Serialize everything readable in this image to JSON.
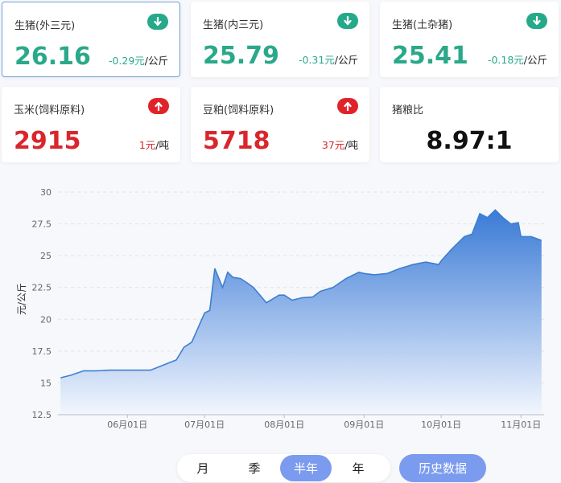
{
  "cards": [
    {
      "name": "生猪(外三元)",
      "price": "26.16",
      "change": "-0.29元",
      "unit": "/公斤",
      "trend": "down",
      "icon": "arrow-down-icon"
    },
    {
      "name": "生猪(内三元)",
      "price": "25.79",
      "change": "-0.31元",
      "unit": "/公斤",
      "trend": "down",
      "icon": "arrow-down-icon"
    },
    {
      "name": "生猪(土杂猪)",
      "price": "25.41",
      "change": "-0.18元",
      "unit": "/公斤",
      "trend": "down",
      "icon": "arrow-down-icon"
    },
    {
      "name": "玉米(饲料原料)",
      "price": "2915",
      "change": "1元",
      "unit": "/吨",
      "trend": "up",
      "icon": "arrow-up-icon"
    },
    {
      "name": "豆粕(饲料原料)",
      "price": "5718",
      "change": "37元",
      "unit": "/吨",
      "trend": "up",
      "icon": "arrow-up-icon"
    },
    {
      "name": "猪粮比",
      "price": "8.97:1"
    }
  ],
  "colors": {
    "down": "#25a98a",
    "up": "#e0232a",
    "accent": "#7b9bef",
    "line": "#3e7fcf",
    "area_top": "#3a7ad6",
    "area_bottom": "#f2f6fe"
  },
  "chart_data": {
    "type": "area",
    "ylabel": "元/公斤",
    "ylim": [
      12.5,
      30
    ],
    "yticks": [
      "12.5",
      "15",
      "17.5",
      "20",
      "22.5",
      "25",
      "27.5",
      "30"
    ],
    "xticks": [
      "06月01日",
      "07月01日",
      "08月01日",
      "09月01日",
      "10月01日",
      "11月01日"
    ],
    "grid": "horizontal dashed",
    "series": [
      {
        "x": [
          "05-06",
          "05-10",
          "05-15",
          "05-20",
          "05-25",
          "06-01",
          "06-05",
          "06-10",
          "06-15",
          "06-20",
          "06-23",
          "06-26",
          "07-01",
          "07-03",
          "07-05",
          "07-08",
          "07-10",
          "07-12",
          "07-15",
          "07-18",
          "07-20",
          "07-25",
          "07-30",
          "08-01",
          "08-04",
          "08-08",
          "08-12",
          "08-15",
          "08-20",
          "08-25",
          "08-30",
          "09-01",
          "09-05",
          "09-10",
          "09-15",
          "09-20",
          "09-25",
          "09-30",
          "10-01",
          "10-05",
          "10-10",
          "10-13",
          "10-16",
          "10-19",
          "10-22",
          "10-25",
          "10-28",
          "10-31",
          "11-01",
          "11-05",
          "11-09"
        ],
        "values": [
          15.4,
          15.6,
          15.95,
          15.95,
          16.0,
          16.0,
          16.0,
          16.0,
          16.4,
          16.8,
          17.8,
          18.2,
          20.5,
          20.7,
          24.0,
          22.5,
          23.7,
          23.3,
          23.2,
          22.8,
          22.5,
          21.3,
          21.9,
          21.9,
          21.5,
          21.7,
          21.75,
          22.2,
          22.5,
          23.2,
          23.7,
          23.6,
          23.5,
          23.6,
          24.0,
          24.3,
          24.5,
          24.3,
          24.6,
          25.5,
          26.5,
          26.7,
          28.3,
          28.0,
          28.6,
          28.0,
          27.5,
          27.6,
          26.5,
          26.5,
          26.2
        ]
      }
    ]
  },
  "periods": [
    "月",
    "季",
    "半年",
    "年"
  ],
  "active_period": "半年",
  "history_label": "历史数据"
}
